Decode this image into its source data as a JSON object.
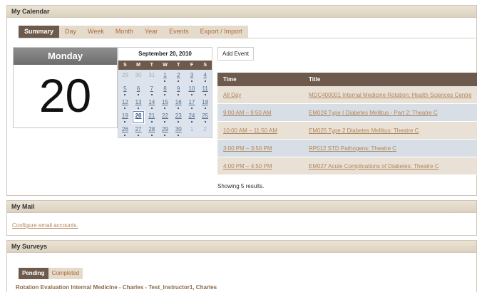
{
  "calendar": {
    "header": "My Calendar",
    "tabs": [
      "Summary",
      "Day",
      "Week",
      "Month",
      "Year",
      "Events",
      "Export / Import"
    ],
    "day_name": "Monday",
    "day_number": "20",
    "mini": {
      "title": "September 20, 2010",
      "weekdays": [
        "S",
        "M",
        "T",
        "W",
        "T",
        "F",
        "S"
      ],
      "weeks": [
        [
          {
            "d": "29",
            "o": true
          },
          {
            "d": "30",
            "o": true
          },
          {
            "d": "31",
            "o": true
          },
          {
            "d": "1",
            "e": true
          },
          {
            "d": "2",
            "e": true
          },
          {
            "d": "3",
            "e": true
          },
          {
            "d": "4",
            "e": true
          }
        ],
        [
          {
            "d": "5",
            "e": true
          },
          {
            "d": "6",
            "e": true
          },
          {
            "d": "7",
            "e": true
          },
          {
            "d": "8",
            "e": true
          },
          {
            "d": "9",
            "e": true
          },
          {
            "d": "10",
            "e": true
          },
          {
            "d": "11",
            "e": true
          }
        ],
        [
          {
            "d": "12",
            "e": true
          },
          {
            "d": "13",
            "e": true
          },
          {
            "d": "14",
            "e": true
          },
          {
            "d": "15",
            "e": true
          },
          {
            "d": "16",
            "e": true
          },
          {
            "d": "17",
            "e": true
          },
          {
            "d": "18",
            "e": true
          }
        ],
        [
          {
            "d": "19",
            "e": true
          },
          {
            "d": "20",
            "t": true
          },
          {
            "d": "21",
            "e": true
          },
          {
            "d": "22",
            "e": true
          },
          {
            "d": "23",
            "e": true
          },
          {
            "d": "24",
            "e": true
          },
          {
            "d": "25",
            "e": true
          }
        ],
        [
          {
            "d": "26",
            "e": true
          },
          {
            "d": "27",
            "e": true
          },
          {
            "d": "28",
            "e": true
          },
          {
            "d": "29",
            "e": true
          },
          {
            "d": "30",
            "e": true
          },
          {
            "d": "1",
            "o": true
          },
          {
            "d": "2",
            "o": true
          }
        ]
      ]
    },
    "add_event_label": "Add Event",
    "table": {
      "col_time": "Time",
      "col_title": "Title",
      "rows": [
        {
          "time": "All Day",
          "title": "MDC400001 Internal Medicine Rotation: Health Sciences Centre"
        },
        {
          "time": "9:00 AM – 9:50 AM",
          "title": "EM024 Type I Diabetes Mellitus - Part 2: Theatre C"
        },
        {
          "time": "10:00 AM – 11:50 AM",
          "title": "EM025 Type 2 Diabetes Mellitus: Theatre C"
        },
        {
          "time": "3:00 PM – 3:50 PM",
          "title": "RP012 STD Pathogens: Theatre C"
        },
        {
          "time": "4:00 PM – 4:50 PM",
          "title": "EM027 Acute Complications of Diabetes: Theatre C"
        }
      ]
    },
    "showing": "Showing 5 results."
  },
  "mail": {
    "header": "My Mail",
    "configure_link": "Configure email accounts."
  },
  "surveys": {
    "header": "My Surveys",
    "tabs": [
      "Pending",
      "Completed"
    ],
    "item": "Rotation Evaluation Internal Medicine - Charles - Test_Instructor1, Charles"
  }
}
